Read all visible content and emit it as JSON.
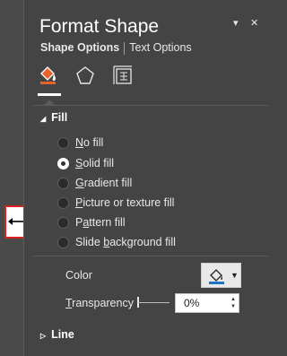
{
  "panel": {
    "title": "Format Shape",
    "dropdown_glyph": "▾",
    "close_glyph": "✕"
  },
  "tabs": {
    "shape_options": "Shape Options",
    "text_options": "Text Options"
  },
  "icons": [
    "fill-and-line-icon",
    "effects-pentagon-icon",
    "size-properties-icon"
  ],
  "fill_section": {
    "title": "Fill",
    "options": [
      {
        "label": "No fill",
        "u": "N",
        "selected": false
      },
      {
        "label": "Solid fill",
        "u": "S",
        "selected": true
      },
      {
        "label": "Gradient fill",
        "u": "G",
        "selected": false
      },
      {
        "label": "Picture or texture fill",
        "u": "P",
        "selected": false
      },
      {
        "label": "Pattern fill",
        "u": "A",
        "selected": false
      },
      {
        "label": "Slide background fill",
        "u": "B",
        "selected": false
      }
    ],
    "color_label": "Color",
    "transparency_label": "Transparency",
    "transparency_value": "0%"
  },
  "line_section": {
    "title": "Line"
  },
  "colors": {
    "fill_icon": "#e8622a",
    "color_swatch": "#1e73c8",
    "highlight": "#e02020"
  },
  "cursor_icon": "resize-horizontal-cursor-icon"
}
